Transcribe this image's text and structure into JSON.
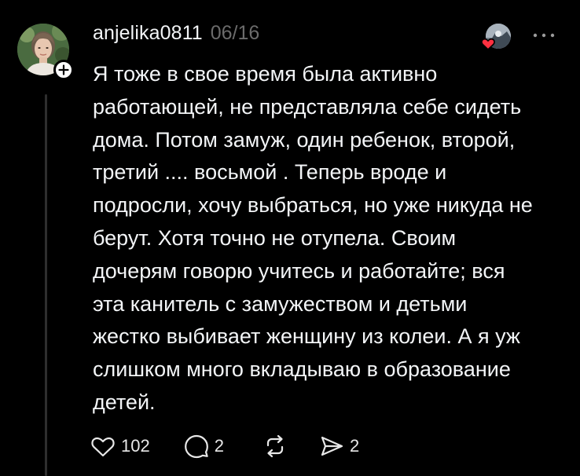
{
  "post": {
    "author": "anjelika0811",
    "timestamp": "06/16",
    "text": "Я тоже в свое время была активно\nработающей, не представляла себе сидеть\nдома. Потом замуж, один ребенок, второй,\nтретий .... восьмой . Теперь вроде и\nподросли, хочу выбраться, но уже никуда не\nберут. Хотя точно не отупела. Своим\nдочерям говорю учитесь и работайте; вся\nэта канитель с замужеством и детьми\nжестко выбивает женщину из колеи. А я уж\nслишком много вкладываю в образование\nдетей."
  },
  "actions": {
    "likes": "102",
    "replies": "2",
    "shares": "2"
  },
  "icons": {
    "follow": "plus-icon",
    "more": "more-horizontal-icon",
    "like": "heart-outline-icon",
    "reply": "speech-bubble-icon",
    "repost": "repost-icon",
    "share": "send-icon",
    "liked_by": "red-heart-icon"
  },
  "colors": {
    "background": "#000000",
    "text": "#f3f5f7",
    "muted": "#6b6b6b",
    "heart_accent": "#ff3040"
  }
}
